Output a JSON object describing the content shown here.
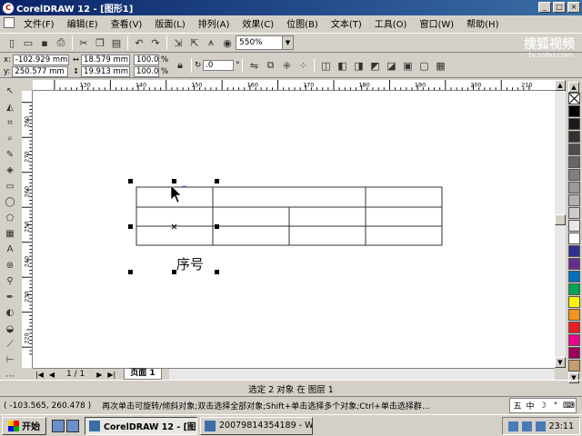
{
  "window": {
    "title": "CorelDRAW 12 - [图形1]",
    "min": "_",
    "max": "□",
    "close": "×"
  },
  "menu": [
    "文件(F)",
    "编辑(E)",
    "查看(V)",
    "版面(L)",
    "排列(A)",
    "效果(C)",
    "位图(B)",
    "文本(T)",
    "工具(O)",
    "窗口(W)",
    "帮助(H)"
  ],
  "toolbar": {
    "zoom": "550%"
  },
  "propbar": {
    "x": "-102.929 mm",
    "y": "250.577 mm",
    "w": "18.579 mm",
    "h": "19.913 mm",
    "sx": "100.0",
    "sy": "100.0",
    "pct": "%",
    "angle": ".0",
    "deg": "°"
  },
  "watermark": {
    "brand": "搜狐视频",
    "site": "tv.sohu.com"
  },
  "ruler": {
    "h": [
      "130",
      "140",
      "150",
      "160",
      "170",
      "180",
      "190",
      "200",
      "210"
    ],
    "v": [
      "280",
      "270",
      "260",
      "250",
      "240",
      "230",
      "220"
    ]
  },
  "canvas": {
    "text": "序号"
  },
  "palette": {
    "colors": [
      "#000000",
      "#1a1a1a",
      "#333333",
      "#4d4d4d",
      "#666666",
      "#808080",
      "#999999",
      "#b3b3b3",
      "#cccccc",
      "#e6e6e6",
      "#ffffff",
      "#2e3192",
      "#662d91",
      "#0071bc",
      "#00a651",
      "#fff200",
      "#f7941d",
      "#ed1c24",
      "#ec008c",
      "#9e005d",
      "#c69c6d"
    ]
  },
  "pagebar": {
    "first": "|◀",
    "prev": "◀",
    "count": "1 / 1",
    "next": "▶",
    "last": "▶|",
    "page": "页面 1"
  },
  "status": {
    "selection": "选定 2 对象 在 图层 1",
    "coords": "( -103.565, 260.478 )",
    "hint": "再次单击可旋转/倾斜对象;双击选择全部对象;Shift+单击选择多个对象;Ctrl+单击选择群..."
  },
  "ime": [
    "五",
    "中",
    "☽",
    "°",
    "⌨"
  ],
  "taskbar": {
    "start": "开始",
    "tasks": [
      "CorelDRAW 12 - [图形1]",
      "20079814354189 - Wind..."
    ],
    "clock": "23:11"
  }
}
